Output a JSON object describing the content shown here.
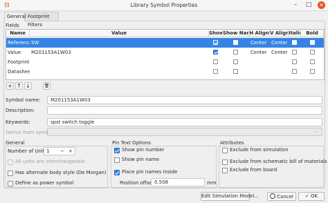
{
  "window": {
    "title": "Library Symbol Properties"
  },
  "tabs": [
    "General",
    "Footprint Filters"
  ],
  "fields_group_label": "Fields",
  "grid": {
    "columns": [
      "Name",
      "Value",
      "Show",
      "Show Name",
      "H Align",
      "V Align",
      "Italic",
      "Bold"
    ],
    "rows": [
      {
        "name": "Reference",
        "value": "SW",
        "show": true,
        "show_name": false,
        "h_align": "Center",
        "v_align": "Center",
        "italic": false,
        "bold": false
      },
      {
        "name": "Value",
        "value": "M201153A1W03",
        "show": true,
        "show_name": false,
        "h_align": "Center",
        "v_align": "Center",
        "italic": false,
        "bold": false
      },
      {
        "name": "Footprint",
        "value": "",
        "show": false,
        "show_name": false,
        "h_align": "",
        "v_align": "",
        "italic": false,
        "bold": false
      },
      {
        "name": "Datasheet",
        "value": "",
        "show": false,
        "show_name": false,
        "h_align": "",
        "v_align": "",
        "italic": false,
        "bold": false
      }
    ]
  },
  "grid_buttons": {
    "add": "+",
    "up": "↑",
    "down": "↓",
    "delete": "🗑"
  },
  "symbol_name": {
    "label": "Symbol name:",
    "value": "M201153A1W03"
  },
  "description": {
    "label": "Description:",
    "value": ""
  },
  "keywords": {
    "label": "Keywords:",
    "value": "spst switch toggle"
  },
  "derive": {
    "label": "Derive from symbol:",
    "value": ""
  },
  "general": {
    "title": "General",
    "units_label": "Number of Units:",
    "units_value": "1",
    "minus": "−",
    "plus": "+",
    "interchangeable": "All units are interchangeable",
    "alternate": "Has alternate body style (De Morgan)",
    "power": "Define as power symbol"
  },
  "pin_text": {
    "title": "Pin Text Options",
    "show_pin_number": "Show pin number",
    "show_pin_name": "Show pin name",
    "place_inside": "Place pin names inside",
    "offset_label": "Position offset:",
    "offset_value": "0.508",
    "offset_unit": "mm"
  },
  "attributes": {
    "title": "Attributes",
    "exclude_sim": "Exclude from simulation",
    "exclude_bom": "Exclude from schematic bill of materials",
    "exclude_board": "Exclude from board"
  },
  "footer": {
    "edit_sim": "Edit Simulation Model...",
    "cancel": "Cancel",
    "ok": "OK"
  }
}
